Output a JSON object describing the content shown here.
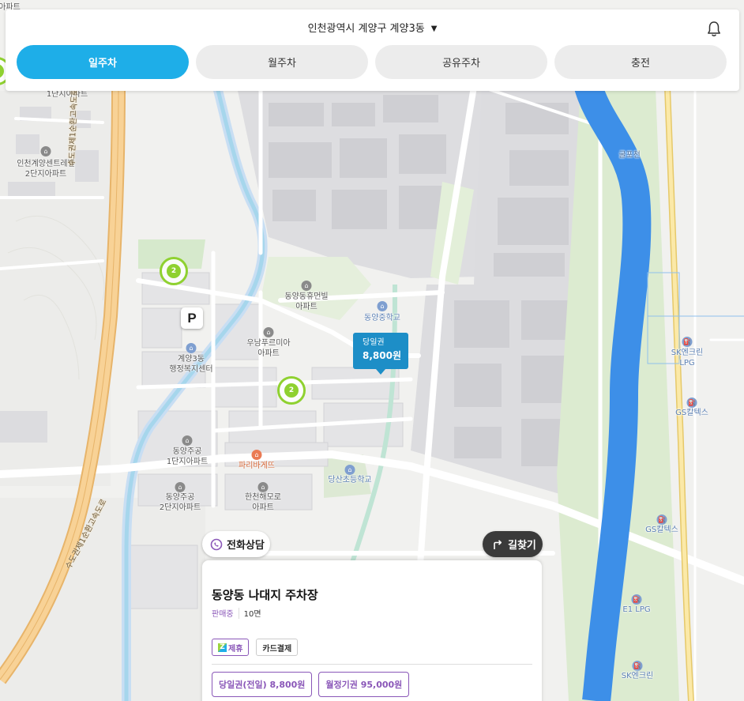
{
  "header": {
    "location": "인천광역시 계양구 계양3동",
    "location_caret": "▼",
    "bell_icon": "bell-icon"
  },
  "tabs": [
    {
      "label": "일주차",
      "active": true
    },
    {
      "label": "월주차",
      "active": false
    },
    {
      "label": "공유주차",
      "active": false
    },
    {
      "label": "충전",
      "active": false
    }
  ],
  "map": {
    "labels": {
      "apt1_top": "1단지아파트",
      "centreville": "인천계양센트레빌\n2단지아파트",
      "gyeyang_center": "계양3동\n행정복지센터",
      "dongyang_hubeon": "동양동휴먼빌\n아파트",
      "dongyang_middle": "동양중학교",
      "unam": "우남푸르미아\n아파트",
      "jugong1": "동양주공\n1단지아파트",
      "paris": "파리바게뜨",
      "dangsan_elem": "당산초등학교",
      "jugong2": "동양주공\n2단지아파트",
      "hancheon": "한천해모로\n아파트",
      "gulpo": "굴포천",
      "sk_lpg": "SK엔크린\nLPG",
      "gs1": "GS칼텍스",
      "gs2": "GS칼텍스",
      "e1": "E1 LPG",
      "sk2": "SK엔크린",
      "top_left_cut": "아파트",
      "expressway_1": "수도권제1순환고속도로",
      "expressway_2": "수도권제1순환고속도로"
    },
    "clusters": [
      {
        "count": "2"
      },
      {
        "count": "2"
      }
    ],
    "parking_marker": "P",
    "price_marker": {
      "type": "당일권",
      "price": "8,800원"
    }
  },
  "actions": {
    "call_label": "전화상담",
    "route_label": "길찾기"
  },
  "card": {
    "title": "동양동 나대지 주차장",
    "status": "판매중",
    "spaces": "10면",
    "badges": {
      "partner": "제휴",
      "partner_logo": "Z",
      "card_payment": "카드결제"
    },
    "prices": [
      "당일권(전일) 8,800원",
      "월정기권 95,000원"
    ]
  },
  "colors": {
    "accent": "#1eaee8",
    "purple": "#8a57b8",
    "river": "#3d8fe8",
    "cluster_green": "#8fd130",
    "price_marker": "#1d8ec7"
  }
}
